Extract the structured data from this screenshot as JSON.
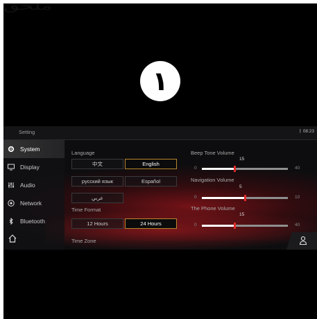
{
  "header_word": "ملحق",
  "step_number": "١",
  "app": {
    "title": "Setting",
    "status": "ᛒ 08:23"
  },
  "sidebar": {
    "items": [
      {
        "label": "System",
        "icon": "gear-icon",
        "active": true
      },
      {
        "label": "Display",
        "icon": "monitor-icon",
        "active": false
      },
      {
        "label": "Audio",
        "icon": "equalizer-icon",
        "active": false
      },
      {
        "label": "Network",
        "icon": "network-icon",
        "active": false
      },
      {
        "label": "Bluetooth",
        "icon": "bluetooth-icon",
        "active": false
      }
    ],
    "home_icon": "home-icon"
  },
  "language": {
    "label": "Language",
    "options": [
      "中文",
      "English",
      "русский язык",
      "Español",
      "عربي"
    ],
    "selected": "English"
  },
  "time_format": {
    "label": "Time Format",
    "options": [
      "12 Hours",
      "24 Hours"
    ],
    "selected": "24 Hours"
  },
  "time_zone": {
    "label": "Time Zone"
  },
  "volumes": [
    {
      "label": "Beep Tone Volume",
      "value": "15",
      "min": "0",
      "max": "40",
      "level": 0.375
    },
    {
      "label": "Navigation Volume",
      "value": "5",
      "min": "0",
      "max": "10",
      "level": 0.5
    },
    {
      "label": "The Phone Volume",
      "value": "15",
      "min": "0",
      "max": "40",
      "level": 0.375
    }
  ],
  "user_icon": "user-icon",
  "colors": {
    "accent_gold": "#b8862f",
    "knob_red": "#e02a2a",
    "background": "#0d0d0f"
  }
}
